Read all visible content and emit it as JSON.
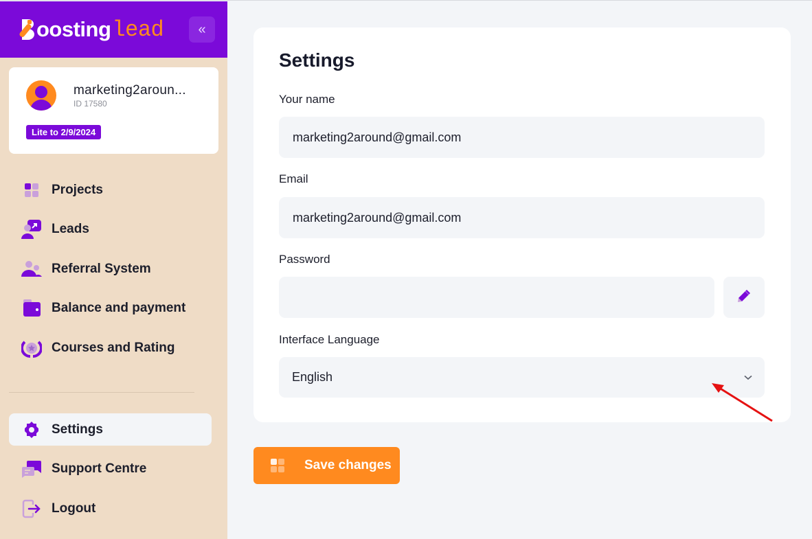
{
  "brand": {
    "logo_white": "oosting",
    "logo_orange": "lead",
    "collapse_icon": "«",
    "colors": {
      "primary": "#7b0ad9",
      "accent": "#ff8a1f",
      "sidebar_bg": "#efdcc6"
    }
  },
  "profile": {
    "name": "marketing2aroun...",
    "id_label": "ID 17580",
    "plan_badge": "Lite to 2/9/2024"
  },
  "sidebar": {
    "main_items": [
      {
        "label": "Projects",
        "icon": "grid-icon"
      },
      {
        "label": "Leads",
        "icon": "leads-icon"
      },
      {
        "label": "Referral System",
        "icon": "users-icon"
      },
      {
        "label": "Balance and payment",
        "icon": "wallet-icon"
      },
      {
        "label": "Courses and Rating",
        "icon": "laurel-star-icon"
      }
    ],
    "bottom_items": [
      {
        "label": "Settings",
        "icon": "gear-icon",
        "active": true
      },
      {
        "label": "Support Centre",
        "icon": "chat-icon"
      },
      {
        "label": "Logout",
        "icon": "logout-icon"
      }
    ]
  },
  "settings": {
    "title": "Settings",
    "name_label": "Your name",
    "name_value": "marketing2around@gmail.com",
    "email_label": "Email",
    "email_value": "marketing2around@gmail.com",
    "password_label": "Password",
    "password_value": "",
    "language_label": "Interface Language",
    "language_value": "English",
    "save_label": "Save changes"
  }
}
